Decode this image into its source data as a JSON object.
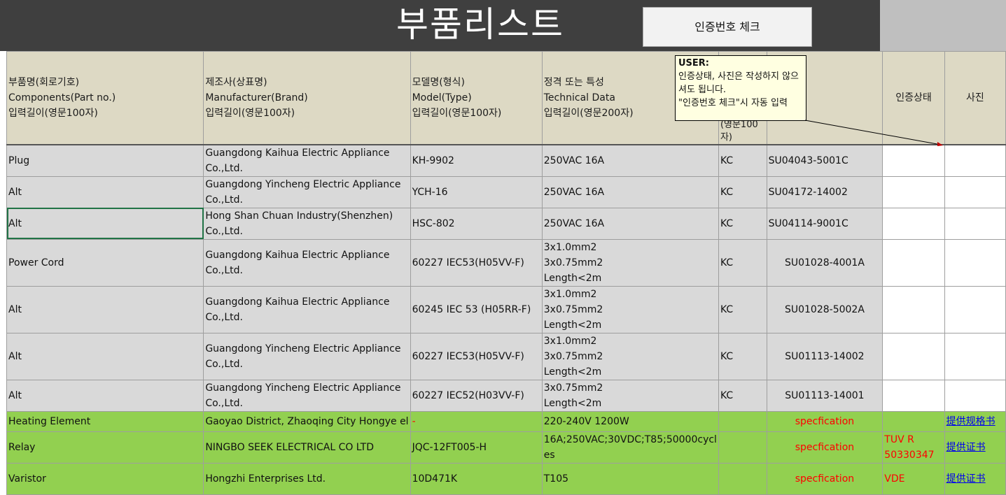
{
  "title": "부품리스트",
  "check_button_label": "인증번호 체크",
  "comment": {
    "author": "USER:",
    "text": "인증상태, 사진은 작성하지 않으셔도 됩니다.\n\"인증번호 체크\"시 자동 입력"
  },
  "header": {
    "component": [
      "부품명(회로기호)",
      "Components(Part no.)",
      "입력길이(영문100자)"
    ],
    "manufacturer": [
      "제조사(상표명)",
      "Manufacturer(Brand)",
      "입력길이(영문100자)"
    ],
    "model": [
      "모델명(형식)",
      "Model(Type)",
      "입력길이(영문100자)"
    ],
    "technical": [
      "정격 또는 특성",
      "Technical Data",
      "입력길이(영문200자)"
    ],
    "cert_partial": [
      "(영문100",
      "자)"
    ],
    "status": "인증상태",
    "photo": "사진"
  },
  "rows": [
    {
      "component": "Plug",
      "manufacturer": [
        "Guangdong Kaihua Electric Appliance",
        "Co.,Ltd."
      ],
      "model": "KH-9902",
      "technical": [
        "250VAC 16A"
      ],
      "cert": "KC",
      "number": "SU04043-5001C",
      "status": [],
      "photo": ""
    },
    {
      "component": "Alt",
      "manufacturer": [
        "Guangdong Yincheng Electric Appliance",
        "Co.,Ltd."
      ],
      "model": "YCH-16",
      "technical": [
        "250VAC 16A"
      ],
      "cert": "KC",
      "number": "SU04172-14002",
      "status": [],
      "photo": ""
    },
    {
      "component": "Alt",
      "manufacturer": [
        "Hong Shan Chuan Industry(Shenzhen)",
        "Co.,Ltd."
      ],
      "model": "HSC-802",
      "technical": [
        "250VAC 16A"
      ],
      "cert": "KC",
      "number": "SU04114-9001C",
      "status": [],
      "photo": ""
    },
    {
      "component": "Power Cord",
      "manufacturer": [
        "Guangdong Kaihua Electric Appliance",
        "Co.,Ltd."
      ],
      "model": "60227 IEC53(H05VV-F)",
      "technical": [
        "3x1.0mm2",
        "3x0.75mm2",
        "Length<2m"
      ],
      "cert": "KC",
      "number": "SU01028-4001A",
      "status": [],
      "photo": ""
    },
    {
      "component": "Alt",
      "manufacturer": [
        "Guangdong Kaihua Electric Appliance",
        "Co.,Ltd."
      ],
      "model": "60245 IEC 53 (H05RR-F)",
      "technical": [
        "3x1.0mm2",
        "3x0.75mm2",
        "Length<2m"
      ],
      "cert": "KC",
      "number": "SU01028-5002A",
      "status": [],
      "photo": ""
    },
    {
      "component": "Alt",
      "manufacturer": [
        "Guangdong Yincheng Electric Appliance",
        "Co.,Ltd."
      ],
      "model": "60227 IEC53(H05VV-F)",
      "technical": [
        "3x1.0mm2",
        "3x0.75mm2",
        "Length<2m"
      ],
      "cert": "KC",
      "number": "SU01113-14002",
      "status": [],
      "photo": ""
    },
    {
      "component": "Alt",
      "manufacturer": [
        "Guangdong Yincheng Electric Appliance",
        "Co.,Ltd."
      ],
      "model": "60227 IEC52(H03VV-F)",
      "technical": [
        "3x0.75mm2",
        "Length<2m"
      ],
      "cert": "KC",
      "number": "SU01113-14001",
      "status": [],
      "photo": ""
    },
    {
      "component": "Heating Element",
      "manufacturer": [
        "Gaoyao District, Zhaoqing City Hongye el"
      ],
      "model": "-",
      "technical": [
        "220-240V 1200W"
      ],
      "cert": "",
      "number": "specfication",
      "status": [],
      "photo": "提供规格书"
    },
    {
      "component": "Relay",
      "manufacturer": [
        "NINGBO SEEK ELECTRICAL CO LTD"
      ],
      "model": "JQC-12FT005-H",
      "technical": [
        "16A;250VAC;30VDC;T85;50000cycl",
        "es"
      ],
      "cert": "",
      "number": "specfication",
      "status": [
        "TUV R",
        "50330347"
      ],
      "photo": "提供证书"
    },
    {
      "component": "Varistor",
      "manufacturer": [
        "Hongzhi Enterprises Ltd."
      ],
      "model": "10D471K",
      "technical": [
        "T105"
      ],
      "cert": "",
      "number": "specfication",
      "status": [
        "VDE"
      ],
      "photo": "提供证书"
    }
  ]
}
